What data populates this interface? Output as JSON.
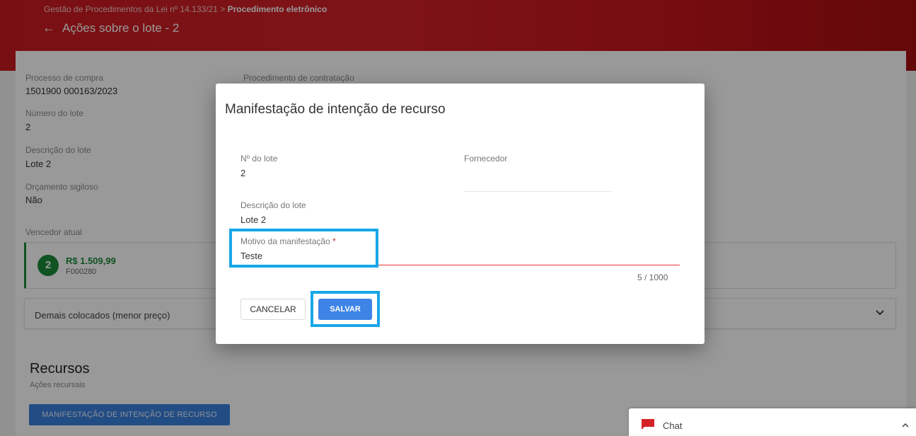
{
  "header": {
    "breadcrumb_prefix": "Gestão de Procedimentos da Lei nº 14.133/21 >",
    "breadcrumb_current": "Procedimento eletrônico",
    "back_icon": "arrow-left-icon",
    "title": "Ações sobre o lote - 2"
  },
  "details": {
    "processo_label": "Processo de compra",
    "processo_value": "1501900 000163/2023",
    "procedimento_label": "Procedimento de contratação",
    "numero_lote_label": "Número do lote",
    "numero_lote_value": "2",
    "descricao_label": "Descrição do lote",
    "descricao_value": "Lote 2",
    "orcamento_label": "Orçamento sigiloso",
    "orcamento_value": "Não"
  },
  "winner": {
    "label": "Vencedor atual",
    "rank": "2",
    "price": "R$ 1.509,99",
    "supplier_code": "F000280"
  },
  "others": {
    "label": "Demais colocados (menor preço)"
  },
  "recursos": {
    "title": "Recursos",
    "subtitle": "Ações recursais",
    "button_label": "MANIFESTAÇÃO DE INTENÇÃO DE RECURSO"
  },
  "modal": {
    "title": "Manifestação de intenção de recurso",
    "lote_label": "Nº do lote",
    "lote_value": "2",
    "fornecedor_label": "Fornecedor",
    "descricao_label": "Descrição do lote",
    "descricao_value": "Lote 2",
    "motivo_label": "Motivo da manifestação",
    "motivo_required": "*",
    "motivo_value": "Teste",
    "counter": "5 / 1000",
    "cancel_label": "CANCELAR",
    "save_label": "SALVAR"
  },
  "chat": {
    "label": "Chat"
  },
  "colors": {
    "header_red": "#c91a20",
    "accent_blue": "#3d84e6",
    "success_green": "#1b8a3a",
    "highlight_cyan": "#17a7e8",
    "error_red": "#e53935"
  }
}
